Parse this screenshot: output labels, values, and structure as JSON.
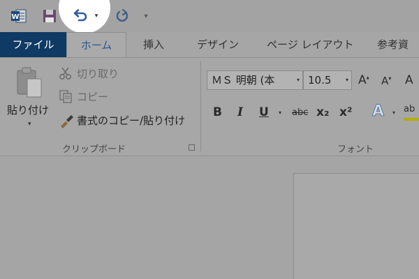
{
  "qat": {
    "app_icon": "word-logo-icon",
    "save_icon": "save-icon",
    "undo_icon": "undo-icon",
    "redo_icon": "redo-icon",
    "dropdown_glyph": "▾",
    "customize_glyph": "▾"
  },
  "tabs": {
    "file": "ファイル",
    "home": "ホーム",
    "insert": "挿入",
    "design": "デザイン",
    "layout": "ページ レイアウト",
    "references": "参考資"
  },
  "clipboard": {
    "paste_label": "貼り付け",
    "cut_label": "切り取り",
    "copy_label": "コピー",
    "format_painter_label": "書式のコピー/貼り付け",
    "group_label": "クリップボード"
  },
  "font": {
    "font_name": "ＭＳ 明朝 (本",
    "font_size": "10.5",
    "grow_label": "A",
    "shrink_label": "A",
    "clear_label": "A",
    "bold_label": "B",
    "italic_label": "I",
    "underline_label": "U",
    "strike_label": "abc",
    "subscript_label": "x₂",
    "superscript_label": "x²",
    "effects_label": "A",
    "highlight_label": "ab",
    "group_label": "フォント"
  },
  "colors": {
    "file_tab": "#0f3a63",
    "active_tab_text": "#26588f",
    "dim_overlay": "#a5a5a5",
    "spotlight": "#ffffff"
  }
}
